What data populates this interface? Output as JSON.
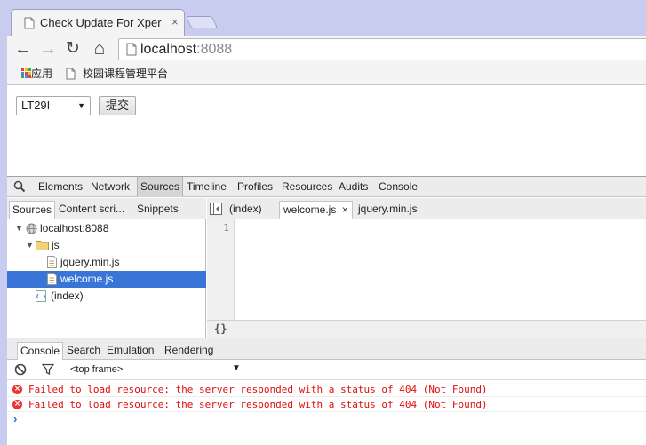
{
  "browser": {
    "tab_title": "Check Update For Xper",
    "tab_close": "×",
    "nav": {
      "back": "←",
      "forward": "→",
      "reload": "↻",
      "home": "⌂"
    },
    "address": {
      "host": "localhost",
      "port": ":8088"
    },
    "bookmarks": [
      {
        "label": "应用",
        "icon": "apps-grid-icon"
      },
      {
        "label": "校园课程管理平台",
        "icon": "page-icon"
      }
    ]
  },
  "page": {
    "select_value": "LT29I",
    "submit_label": "提交"
  },
  "devtools": {
    "panels": [
      "Elements",
      "Network",
      "Sources",
      "Timeline",
      "Profiles",
      "Resources",
      "Audits",
      "Console"
    ],
    "active_panel": "Sources",
    "navigator_tabs": [
      "Sources",
      "Content scri...",
      "Snippets"
    ],
    "tree": {
      "host": "localhost:8088",
      "folder": "js",
      "files": [
        "jquery.min.js",
        "welcome.js"
      ],
      "selected": "welcome.js",
      "index": "(index)"
    },
    "editor_tabs": [
      "(index)",
      "welcome.js",
      "jquery.min.js"
    ],
    "editor_tab_close": "×",
    "active_editor_tab": "welcome.js",
    "line_numbers": [
      "1"
    ],
    "pretty_print": "{}",
    "drawer_tabs": [
      "Console",
      "Search",
      "Emulation",
      "Rendering"
    ],
    "frame_context": "<top frame>",
    "console_messages": [
      "Failed to load resource: the server responded with a status of 404 (Not Found)",
      "Failed to load resource: the server responded with a status of 404 (Not Found)"
    ],
    "prompt_symbol": "›"
  },
  "colors": {
    "frame": "#c8cdf0",
    "selection": "#3875d7",
    "error_text": "#e10e0e",
    "prompt": "#2a6ed8"
  }
}
